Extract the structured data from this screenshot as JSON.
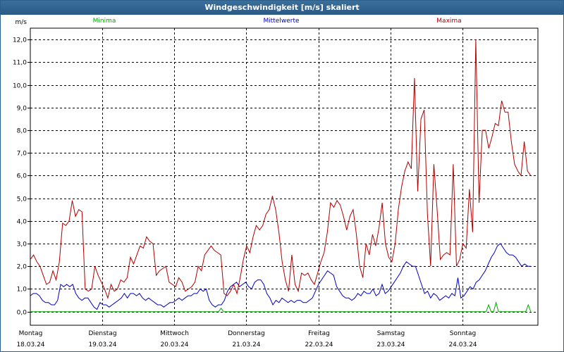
{
  "window": {
    "title": "Windgeschwindigkeit [m/s] skaliert"
  },
  "chart_data": {
    "type": "line",
    "title": "Windgeschwindigkeit [m/s] skaliert",
    "ylabel": "m/s",
    "ylim": [
      -0.6,
      12.5
    ],
    "yticks": [
      "0,0",
      "1,0",
      "2,0",
      "3,0",
      "4,0",
      "5,0",
      "6,0",
      "7,0",
      "8,0",
      "9,0",
      "10,0",
      "11,0",
      "12,0"
    ],
    "ytick_values": [
      0,
      1,
      2,
      3,
      4,
      5,
      6,
      7,
      8,
      9,
      10,
      11,
      12
    ],
    "xlim": [
      0,
      7.05
    ],
    "days": [
      {
        "name": "Montag",
        "date": "18.03.24"
      },
      {
        "name": "Dienstag",
        "date": "19.03.24"
      },
      {
        "name": "Mittwoch",
        "date": "20.03.24"
      },
      {
        "name": "Donnerstag",
        "date": "21.03.24"
      },
      {
        "name": "Freitag",
        "date": "22.03.24"
      },
      {
        "name": "Samstag",
        "date": "23.03.24"
      },
      {
        "name": "Sonntag",
        "date": "24.03.24"
      }
    ],
    "grid": true,
    "legend_position": "top",
    "series": [
      {
        "name": "Minima",
        "color": "#00aa00",
        "values": [
          0,
          0,
          0,
          0,
          0,
          0,
          0,
          0,
          0,
          0,
          0,
          0,
          0,
          0,
          0,
          0,
          0,
          0,
          0,
          0,
          0,
          0,
          0,
          0,
          0,
          0,
          0,
          0,
          0,
          0,
          0,
          0,
          0,
          0,
          0,
          0,
          0,
          0,
          0,
          0,
          0,
          0,
          0,
          0,
          0,
          0,
          0,
          0,
          0,
          0,
          0,
          0,
          0,
          0,
          0,
          0,
          0,
          0,
          0,
          0,
          0,
          0,
          0,
          0,
          0,
          0,
          0,
          0,
          0,
          0,
          0,
          0,
          0,
          0,
          0,
          0,
          0,
          0.15,
          0,
          0,
          0,
          0,
          0,
          0,
          0,
          0,
          0,
          0,
          0,
          0,
          0,
          0,
          0,
          0,
          0,
          0,
          0,
          0,
          0,
          0,
          0,
          0,
          0,
          0,
          0,
          0,
          0,
          0,
          0,
          0,
          0,
          0,
          0,
          0,
          0,
          0,
          0,
          0,
          0,
          0,
          0,
          0,
          0,
          0,
          0,
          0,
          0,
          0,
          0,
          0,
          0,
          0,
          0,
          0,
          0,
          0,
          0,
          0,
          0,
          0,
          0,
          0,
          0,
          0,
          0,
          0,
          0,
          0,
          0,
          0,
          0,
          0,
          0,
          0,
          0,
          0,
          0,
          0,
          0,
          0,
          0,
          0,
          0,
          0,
          0,
          0,
          0,
          0,
          0,
          0,
          0,
          0,
          0,
          0,
          0,
          0,
          0,
          0,
          0,
          0,
          0,
          0,
          0,
          0,
          0,
          0.3,
          0,
          0,
          0.4,
          0,
          0,
          0,
          0,
          0,
          0,
          0,
          0,
          0,
          0,
          0,
          0,
          0.3,
          0
        ]
      },
      {
        "name": "Mittelwerte",
        "color": "#0000c0",
        "values": [
          0.7,
          0.8,
          0.8,
          0.7,
          0.5,
          0.4,
          0.4,
          0.3,
          0.3,
          0.5,
          1.2,
          1.1,
          1.2,
          1.1,
          1.2,
          0.8,
          0.6,
          0.5,
          0.6,
          0.6,
          0.4,
          0.2,
          0.1,
          0.4,
          0.3,
          0.3,
          0.2,
          0.3,
          0.4,
          0.5,
          0.6,
          0.8,
          0.6,
          0.8,
          0.8,
          0.7,
          0.8,
          0.6,
          0.5,
          0.6,
          0.5,
          0.4,
          0.3,
          0.3,
          0.2,
          0.3,
          0.4,
          0.4,
          0.5,
          0.6,
          0.5,
          0.6,
          0.7,
          0.7,
          0.8,
          0.8,
          1.0,
          0.9,
          1.0,
          0.5,
          0.3,
          0.2,
          0.3,
          0.3,
          0.5,
          0.9,
          1.1,
          1.2,
          1.3,
          1.1,
          1.2,
          1.3,
          1.1,
          1.0,
          1.3,
          1.4,
          1.4,
          1.2,
          0.8,
          0.6,
          0.3,
          0.5,
          0.4,
          0.6,
          0.5,
          0.4,
          0.5,
          0.4,
          0.5,
          0.5,
          0.4,
          0.4,
          0.5,
          0.6,
          0.9,
          1.2,
          1.4,
          1.6,
          1.8,
          1.7,
          1.6,
          1.1,
          0.9,
          0.7,
          0.6,
          0.6,
          0.5,
          0.6,
          0.8,
          0.7,
          0.9,
          0.8,
          0.8,
          1.0,
          0.7,
          0.8,
          1.2,
          0.8,
          0.9,
          1.1,
          1.3,
          1.5,
          1.7,
          2.0,
          2.2,
          2.1,
          2.0,
          2.0,
          1.6,
          1.2,
          0.8,
          0.9,
          0.6,
          0.8,
          0.7,
          0.5,
          0.6,
          0.7,
          0.6,
          0.8,
          0.7,
          1.5,
          0.6,
          0.7,
          0.9,
          1.1,
          1.0,
          1.3,
          1.4,
          1.6,
          1.8,
          2.1,
          2.4,
          2.6,
          2.9,
          3.0,
          2.8,
          2.6,
          2.5,
          2.5,
          2.4,
          2.2,
          2.0,
          2.1,
          2.0,
          2.0
        ]
      },
      {
        "name": "Maxima",
        "color": "#b00000",
        "values": [
          2.3,
          2.5,
          2.2,
          2.0,
          1.6,
          1.2,
          1.3,
          1.8,
          1.4,
          2.2,
          3.9,
          3.8,
          4.0,
          4.9,
          4.2,
          4.5,
          4.4,
          1.0,
          0.9,
          1.0,
          2.0,
          1.6,
          1.3,
          1.0,
          0.6,
          1.2,
          0.9,
          1.0,
          1.4,
          1.3,
          1.5,
          2.4,
          2.1,
          2.5,
          2.9,
          2.8,
          3.3,
          3.1,
          3.0,
          1.6,
          1.8,
          1.9,
          2.0,
          1.3,
          1.2,
          1.1,
          1.5,
          1.3,
          0.9,
          1.0,
          1.1,
          1.3,
          2.0,
          1.8,
          2.5,
          2.7,
          2.9,
          2.7,
          2.6,
          2.5,
          0.8,
          0.7,
          0.9,
          1.2,
          0.8,
          1.5,
          2.3,
          2.9,
          2.6,
          3.3,
          3.8,
          3.6,
          3.8,
          4.3,
          4.5,
          5.1,
          4.5,
          3.5,
          2.2,
          1.4,
          0.9,
          2.5,
          1.2,
          0.9,
          1.7,
          1.6,
          1.7,
          1.4,
          1.2,
          1.7,
          2.2,
          2.6,
          3.5,
          4.8,
          4.6,
          4.9,
          4.7,
          4.2,
          3.6,
          4.2,
          4.5,
          3.4,
          2.0,
          1.5,
          3.0,
          2.5,
          3.4,
          2.9,
          3.7,
          4.8,
          3.0,
          2.4,
          2.2,
          3.0,
          4.5,
          5.5,
          6.2,
          6.6,
          6.3,
          10.3,
          5.3,
          8.5,
          8.9,
          4.3,
          2.0,
          6.5,
          4.5,
          2.3,
          2.5,
          2.6,
          2.5,
          6.5,
          2.0,
          2.3,
          3.0,
          2.8,
          5.4,
          3.5,
          12.0,
          4.8,
          8.0,
          8.0,
          7.2,
          7.7,
          8.3,
          8.2,
          9.3,
          8.8,
          8.8,
          7.5,
          6.5,
          6.2,
          6.0,
          7.5,
          6.2,
          6.0
        ]
      }
    ]
  }
}
